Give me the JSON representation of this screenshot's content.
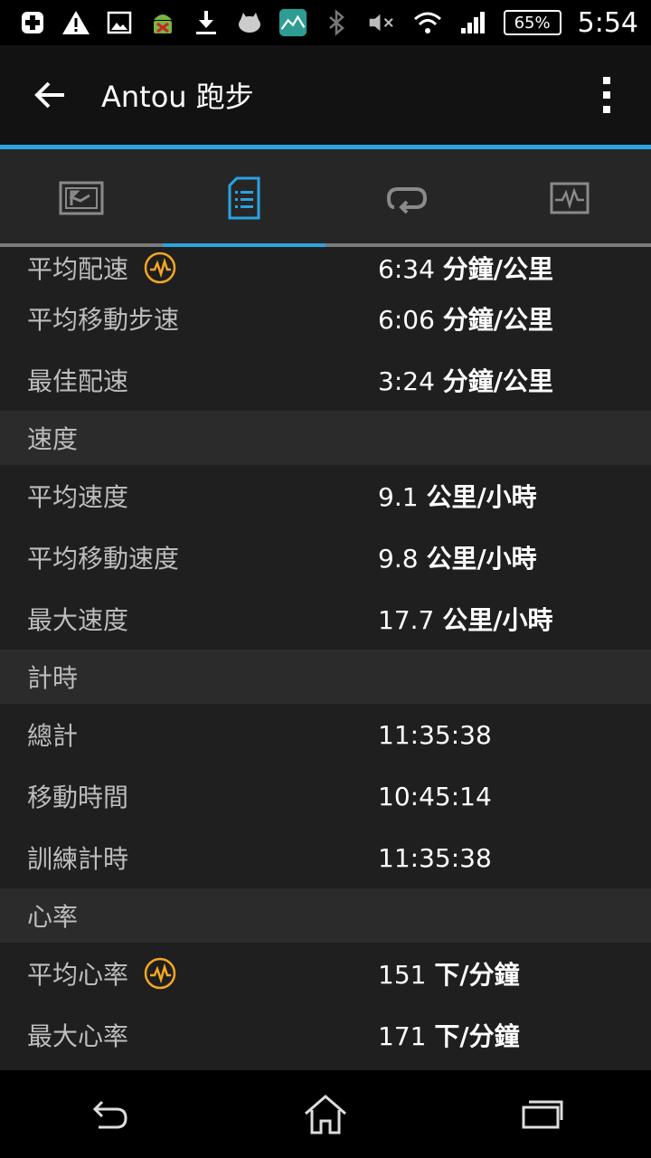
{
  "status_bar": {
    "icons": [
      "plus-cross-icon",
      "warning-icon",
      "image-icon",
      "android-icon",
      "download-icon",
      "cat-icon",
      "mountain-app-icon"
    ],
    "right_icons": [
      "bluetooth-icon",
      "mute-icon",
      "wifi-icon",
      "signal-icon"
    ],
    "battery": "65%",
    "time": "5:54"
  },
  "app_bar": {
    "title": "Antou 跑步"
  },
  "tabs": [
    {
      "icon": "map-icon",
      "active": false
    },
    {
      "icon": "list-document-icon",
      "active": true
    },
    {
      "icon": "loop-icon",
      "active": false
    },
    {
      "icon": "chart-icon",
      "active": false
    }
  ],
  "colors": {
    "accent": "#2aa3e2",
    "orange": "#f5a623"
  },
  "pace_rows": [
    {
      "label": "平均配速",
      "num": "6:34",
      "unit": "分鐘/公里",
      "icon": "heart-rate-icon"
    },
    {
      "label": "平均移動步速",
      "num": "6:06",
      "unit": "分鐘/公里"
    },
    {
      "label": "最佳配速",
      "num": "3:24",
      "unit": "分鐘/公里"
    }
  ],
  "speed": {
    "header": "速度",
    "rows": [
      {
        "label": "平均速度",
        "num": "9.1",
        "unit": "公里/小時"
      },
      {
        "label": "平均移動速度",
        "num": "9.8",
        "unit": "公里/小時"
      },
      {
        "label": "最大速度",
        "num": "17.7",
        "unit": "公里/小時"
      }
    ]
  },
  "timing": {
    "header": "計時",
    "rows": [
      {
        "label": "總計",
        "num": "11:35:38"
      },
      {
        "label": "移動時間",
        "num": "10:45:14"
      },
      {
        "label": "訓練計時",
        "num": "11:35:38"
      }
    ]
  },
  "heart": {
    "header": "心率",
    "rows": [
      {
        "label": "平均心率",
        "num": "151",
        "unit": "下/分鐘",
        "icon": "heart-rate-icon"
      },
      {
        "label": "最大心率",
        "num": "171",
        "unit": "下/分鐘"
      }
    ]
  },
  "nav_bar": [
    "back-nav-icon",
    "home-nav-icon",
    "recents-nav-icon"
  ]
}
